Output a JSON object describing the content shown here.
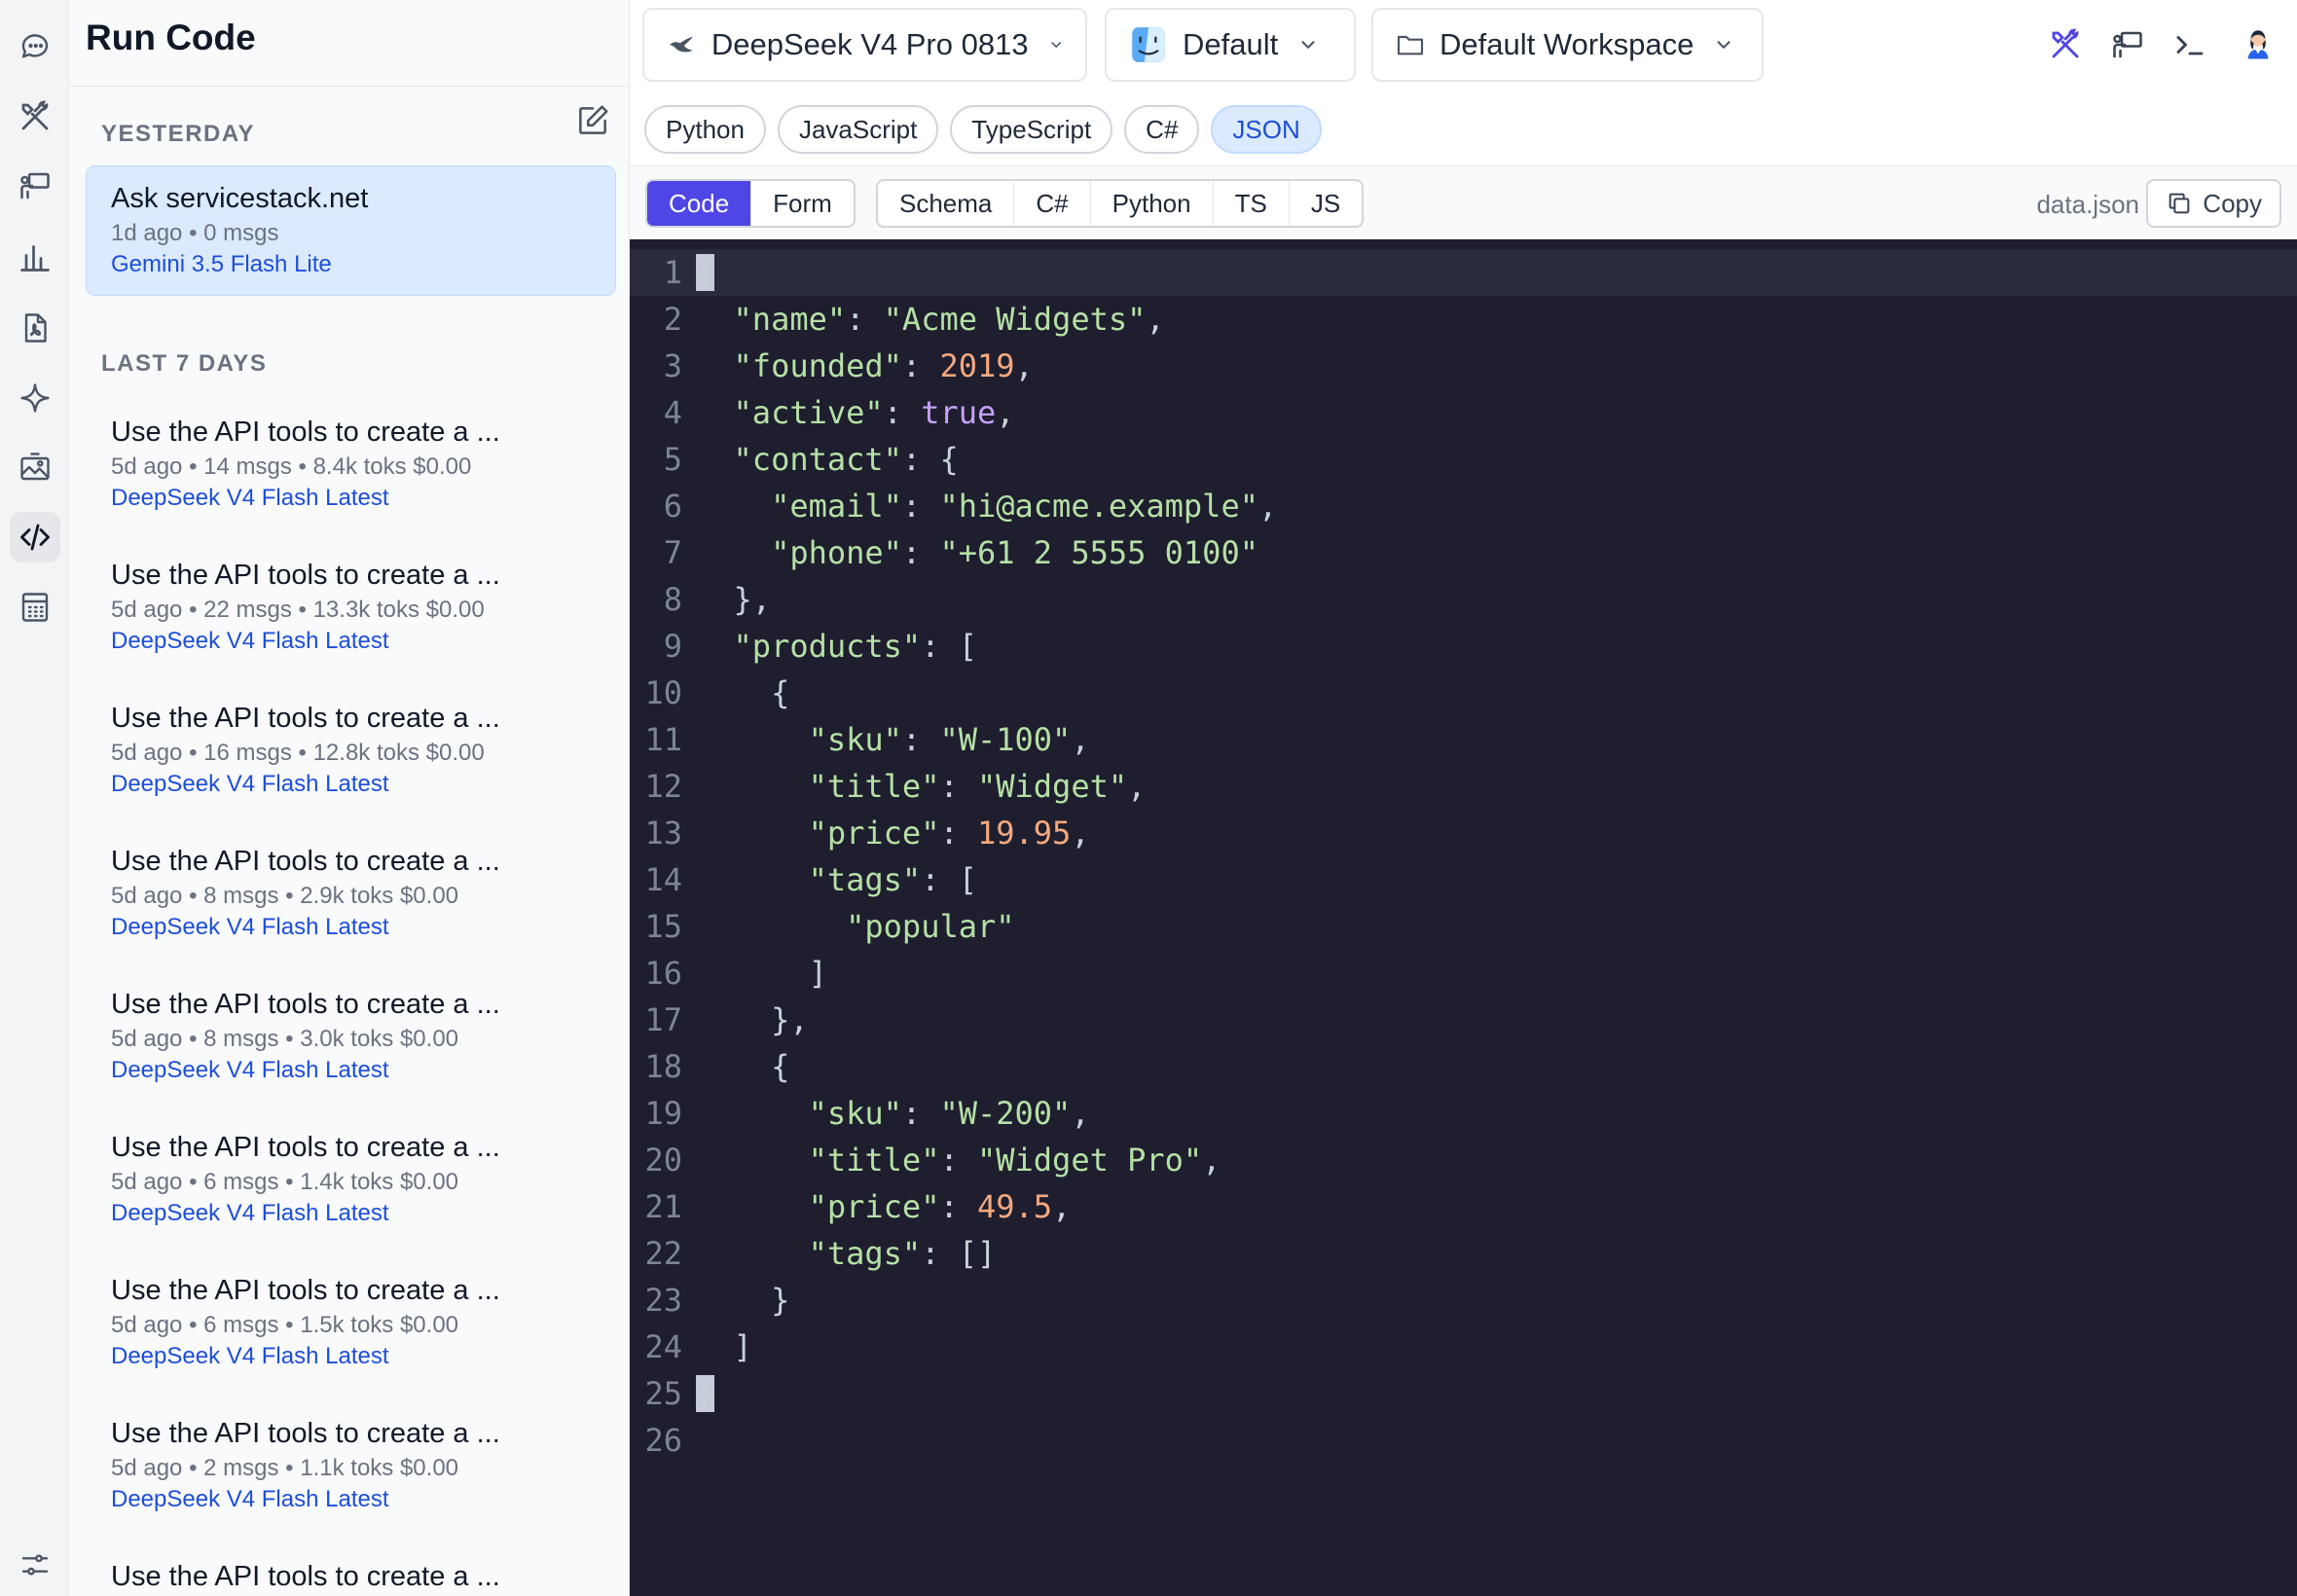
{
  "rail": {
    "icons": [
      "chat-icon",
      "tools-icon",
      "presentation-icon",
      "analytics-icon",
      "pdf-icon",
      "sparkle-icon",
      "image-icon",
      "code-icon",
      "calculator-icon"
    ],
    "active": "code-icon",
    "bottom_icon": "sliders-icon"
  },
  "sidebar": {
    "title": "Run Code",
    "sections": [
      {
        "label": "YESTERDAY",
        "threads": [
          {
            "title": "Ask servicestack.net",
            "meta": "1d ago • 0 msgs",
            "model": "Gemini 3.5 Flash Lite",
            "active": true
          }
        ]
      },
      {
        "label": "LAST 7 DAYS",
        "threads": [
          {
            "title": "Use the API tools to create a ...",
            "meta": "5d ago • 14 msgs • 8.4k toks $0.00",
            "model": "DeepSeek V4 Flash Latest"
          },
          {
            "title": "Use the API tools to create a ...",
            "meta": "5d ago • 22 msgs • 13.3k toks $0.00",
            "model": "DeepSeek V4 Flash Latest"
          },
          {
            "title": "Use the API tools to create a ...",
            "meta": "5d ago • 16 msgs • 12.8k toks $0.00",
            "model": "DeepSeek V4 Flash Latest"
          },
          {
            "title": "Use the API tools to create a ...",
            "meta": "5d ago • 8 msgs • 2.9k toks $0.00",
            "model": "DeepSeek V4 Flash Latest"
          },
          {
            "title": "Use the API tools to create a ...",
            "meta": "5d ago • 8 msgs • 3.0k toks $0.00",
            "model": "DeepSeek V4 Flash Latest"
          },
          {
            "title": "Use the API tools to create a ...",
            "meta": "5d ago • 6 msgs • 1.4k toks $0.00",
            "model": "DeepSeek V4 Flash Latest"
          },
          {
            "title": "Use the API tools to create a ...",
            "meta": "5d ago • 6 msgs • 1.5k toks $0.00",
            "model": "DeepSeek V4 Flash Latest"
          },
          {
            "title": "Use the API tools to create a ...",
            "meta": "5d ago • 2 msgs • 1.1k toks $0.00",
            "model": "DeepSeek V4 Flash Latest"
          },
          {
            "title": "Use the API tools to create a ...",
            "meta": "",
            "model": ""
          }
        ]
      }
    ]
  },
  "toolbar": {
    "model": "DeepSeek V4 Pro 0813",
    "profile": "Default",
    "workspace": "Default Workspace",
    "right_icons": [
      "tools-icon",
      "presentation-icon",
      "terminal-icon",
      "avatar"
    ]
  },
  "languages": {
    "items": [
      "Python",
      "JavaScript",
      "TypeScript",
      "C#",
      "JSON"
    ],
    "active": "JSON"
  },
  "view_tabs": {
    "primary": [
      "Code",
      "Form"
    ],
    "active": "Code",
    "secondary": [
      "Schema",
      "C#",
      "Python",
      "TS",
      "JS"
    ],
    "filename": "data.json",
    "copy_label": "Copy"
  },
  "editor": {
    "current_line": 1,
    "lines": [
      "{",
      "  \"name\": \"Acme Widgets\",",
      "  \"founded\": 2019,",
      "  \"active\": true,",
      "  \"contact\": {",
      "    \"email\": \"hi@acme.example\",",
      "    \"phone\": \"+61 2 5555 0100\"",
      "  },",
      "  \"products\": [",
      "    {",
      "      \"sku\": \"W-100\",",
      "      \"title\": \"Widget\",",
      "      \"price\": 19.95,",
      "      \"tags\": [",
      "        \"popular\"",
      "      ]",
      "    },",
      "    {",
      "      \"sku\": \"W-200\",",
      "      \"title\": \"Widget Pro\",",
      "      \"price\": 49.5,",
      "      \"tags\": []",
      "    }",
      "  ]",
      "}",
      ""
    ]
  },
  "colors": {
    "accent": "#4f46e5",
    "selected_bg": "#dbeafe",
    "link": "#1d4ed8",
    "editor_bg": "#1e1e2e"
  }
}
